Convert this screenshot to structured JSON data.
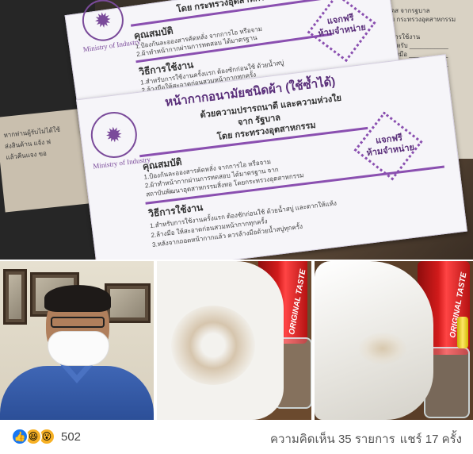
{
  "top_photo": {
    "pack_back": {
      "section_usage_label": "คุณสมบัติ",
      "section_howto_label": "วิธีการใช้งาน",
      "stamp_line1": "แจกฟรี",
      "stamp_line2": "ห้ามจำหน่าย",
      "ministry_by": "โดย กระทรวงอุตสาหกรรม",
      "ministry_seal_text": "Ministry of Industry"
    },
    "pack_front": {
      "title": "หน้ากากอนามัยชนิดผ้า (ใช้ซ้ำได้)",
      "line_kindness": "ด้วยความปรารถนาดี และความห่วงใย",
      "line_from": "จาก รัฐบาล",
      "line_by": "โดย กระทรวงอุตสาหกรรม",
      "ministry_seal_text": "Ministry of Industry",
      "section_usage_label": "คุณสมบัติ",
      "usage_lines": [
        "1.ป้องกันละอองสารคัดหลั่ง จากการไอ หรือจาม",
        "2.ผ้าทำหน้ากากผ่านการทดสอบ ได้มาตรฐาน จาก",
        "สถาบันพัฒนาอุตสาหกรรมสิ่งทอ โดยกระทรวงอุตสาหกรรม"
      ],
      "section_howto_label": "วิธีการใช้งาน",
      "howto_lines": [
        "1.สำหรับการใช้งานครั้งแรก ต้องซักก่อนใช้ ด้วยน้ำสบู่ และตากให้แห้ง",
        "2.ล้างมือ ให้สะอาดก่อนสวมหน้ากากทุกครั้ง",
        "3.หลังจากถอดหน้ากากแล้ว ควรล้างมือด้วยน้ำสบู่ทุกครั้ง"
      ],
      "stamp_line1": "แจกฟรี",
      "stamp_line2": "ห้ามจำหน่าย"
    },
    "left_paper_lines": [
      "หากท่านผู้รับไม่ได้ใช้",
      "ส่งสินค้าน แจ้ง ฟ",
      "แล้วคืนแจง ขอ"
    ]
  },
  "photos": {
    "can_label_left": "ORIGINAL TASTE",
    "can_label_right": "ORIGINAL TASTE"
  },
  "footer": {
    "reaction_icons": [
      "like-icon",
      "haha-icon",
      "wow-icon"
    ],
    "reaction_count": "502",
    "comments_text": "ความคิดเห็น 35 รายการ",
    "shares_text": "แชร์ 17 ครั้ง"
  }
}
